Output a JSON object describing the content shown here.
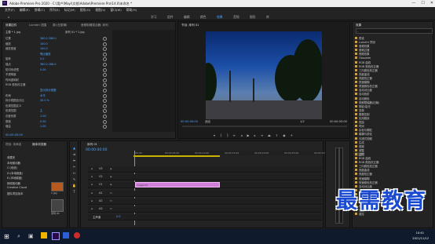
{
  "window": {
    "title": "Adobe Premiere Pro 2020 - C:\\用户\\Mayi\\文档\\Adobe\\Premiere Pro\\14.0\\未命名 *"
  },
  "menu": [
    "文件(F)",
    "编辑(E)",
    "剪辑(C)",
    "序列(S)",
    "标记(M)",
    "图形(G)",
    "视图(V)",
    "窗口(W)",
    "帮助(H)"
  ],
  "workspaces": [
    "学习",
    "组件",
    "编辑",
    "颜色",
    "效果",
    "音频",
    "图形",
    "库"
  ],
  "workspace_active": "效果",
  "effect_controls": {
    "tabs": [
      "效果控件",
      "Lumetri 范围",
      "源:(无剪辑)",
      "音频剪辑混合器: 序列"
    ],
    "source": "主要 * 1.jpg",
    "sequence": "序列 01 * 1.jpg",
    "rows": [
      {
        "label": "位置",
        "value": "360.0   288.0"
      },
      {
        "label": "缩放",
        "value": "100.0"
      },
      {
        "label": "缩放宽度",
        "value": "100.0"
      },
      {
        "label": "",
        "value": "等比缩放"
      },
      {
        "label": "旋转",
        "value": "0.0"
      },
      {
        "label": "锚点",
        "value": "360.0   288.0"
      },
      {
        "label": "防闪烁滤镜",
        "value": "0.00"
      },
      {
        "label": "不透明度",
        "value": ""
      },
      {
        "label": "时间重映射",
        "value": ""
      },
      {
        "label": "RGB 颜色校正器",
        "value": ""
      },
      {
        "label": "",
        "value": "显示拆分视图"
      },
      {
        "label": "布局",
        "value": "水平"
      },
      {
        "label": "拆分视图百分比",
        "value": "50.0 %"
      },
      {
        "label": "色调范围定义",
        "value": ""
      },
      {
        "label": "色调范围",
        "value": "主"
      },
      {
        "label": "灰度系数",
        "value": "1.00"
      },
      {
        "label": "基值",
        "value": "0.00"
      },
      {
        "label": "增益",
        "value": "1.00"
      }
    ],
    "timecode": "00:00:00:00"
  },
  "program_monitor": {
    "title": "节目: 序列 01",
    "timecode": "00:00:00:00",
    "fit": "适合",
    "ratio": "1/2",
    "duration": "00:00:05:00"
  },
  "effects_panel": {
    "title": "效果",
    "items": [
      {
        "label": "预设",
        "hl": false
      },
      {
        "label": "Lumetri 预设",
        "hl": false
      },
      {
        "label": "音频效果",
        "hl": false
      },
      {
        "label": "音频过渡",
        "hl": false
      },
      {
        "label": "视频效果",
        "hl": false
      },
      {
        "label": "Obsolete",
        "hl": false
      },
      {
        "label": "RGB 曲线",
        "hl": false
      },
      {
        "label": "RGB 颜色校正器",
        "hl": false
      },
      {
        "label": "三向颜色校正器",
        "hl": false
      },
      {
        "label": "亮度曲线",
        "hl": false
      },
      {
        "label": "亮度校正器",
        "hl": false
      },
      {
        "label": "快速模糊",
        "hl": false
      },
      {
        "label": "快速颜色校正器",
        "hl": false
      },
      {
        "label": "自动对比度",
        "hl": false
      },
      {
        "label": "自动色阶",
        "hl": false
      },
      {
        "label": "自动颜色",
        "hl": false
      },
      {
        "label": "视频限幅器(旧版)",
        "hl": false
      },
      {
        "label": "阴影/高光",
        "hl": false
      },
      {
        "label": "变换",
        "hl": false
      },
      {
        "label": "图像控制",
        "hl": false
      },
      {
        "label": "实用程序",
        "hl": false
      },
      {
        "label": "扭曲",
        "hl": false
      },
      {
        "label": "时间",
        "hl": false
      },
      {
        "label": "杂色与颗粒",
        "hl": false
      },
      {
        "label": "模糊与锐化",
        "hl": false
      },
      {
        "label": "沉浸式视频",
        "hl": false
      },
      {
        "label": "生成",
        "hl": false
      },
      {
        "label": "视频",
        "hl": false
      },
      {
        "label": "调整",
        "hl": false
      },
      {
        "label": "过时",
        "hl": true
      },
      {
        "label": "RGB 曲线",
        "hl": false
      },
      {
        "label": "RGB 颜色校正器",
        "hl": false
      },
      {
        "label": "三向颜色校正器",
        "hl": false
      },
      {
        "label": "亮度曲线",
        "hl": false
      },
      {
        "label": "亮度校正器",
        "hl": false
      },
      {
        "label": "快速模糊",
        "hl": false
      },
      {
        "label": "快速颜色校正器",
        "hl": false
      },
      {
        "label": "自动对比度",
        "hl": false
      },
      {
        "label": "自动色阶",
        "hl": false
      },
      {
        "label": "自动颜色",
        "hl": false
      },
      {
        "label": "阴影/高光",
        "hl": false
      },
      {
        "label": "过渡",
        "hl": false
      },
      {
        "label": "透视",
        "hl": false
      },
      {
        "label": "通道",
        "hl": false
      },
      {
        "label": "键控",
        "hl": false
      }
    ]
  },
  "project": {
    "tabs": [
      "项目: 未命名",
      "媒体浏览器"
    ],
    "items": [
      "收藏夹",
      "本地驱动器",
      "C:(系统)",
      "D:(本地磁盘)",
      "E:(本地磁盘)",
      "网络驱动器",
      "Creative Cloud",
      "团队项目版本"
    ],
    "thumbs": [
      {
        "label": "1.jpg"
      },
      {
        "label": "序列 01"
      }
    ]
  },
  "timeline": {
    "title": "序列 01",
    "timecode": "00:00:00:00",
    "tracks": [
      "V3",
      "V2",
      "V1",
      "A1",
      "A2",
      "A3",
      "主声道"
    ],
    "master_value": "0.0",
    "clip_label": "1.jpg [V]",
    "ruler": [
      "00:00",
      "00:00:05:00",
      "00:00:10:00",
      "00:00:15:00",
      "00:00:20:00",
      "00:00:25:00",
      "00:00:30:00"
    ]
  },
  "taskbar": {
    "time": "10:41",
    "date": "2021/11/12"
  },
  "watermark": "最需教育"
}
